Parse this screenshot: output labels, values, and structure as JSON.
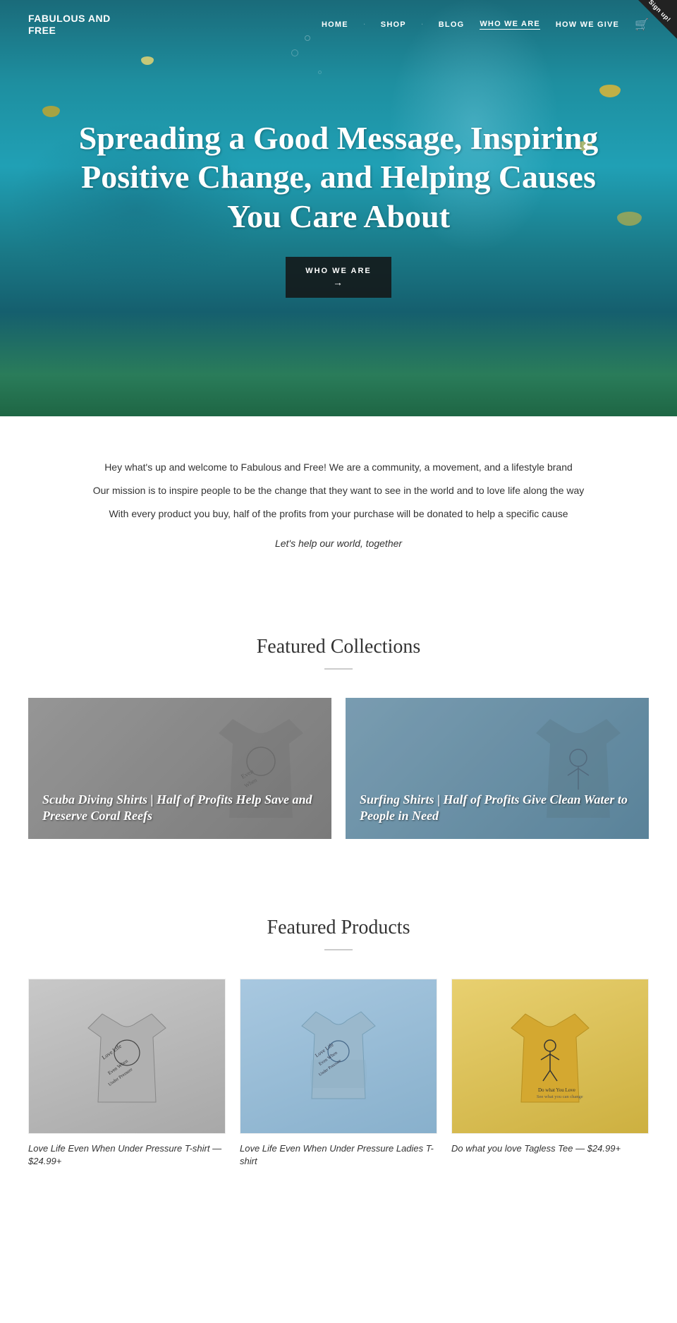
{
  "header": {
    "logo_line1": "FABULOUS AND",
    "logo_line2": "FREE",
    "nav": [
      {
        "label": "HOME",
        "active": false
      },
      {
        "label": "SHOP",
        "active": false,
        "has_dropdown": true
      },
      {
        "label": "BLOG",
        "active": false
      },
      {
        "label": "WHO WE ARE",
        "active": true
      },
      {
        "label": "HOW WE GIVE",
        "active": false
      }
    ],
    "signup_badge": "Sign up!"
  },
  "hero": {
    "title": "Spreading a Good Message, Inspiring Positive Change, and Helping Causes You Care About",
    "cta_button": "WHO WE ARE",
    "cta_arrow": "→"
  },
  "intro": {
    "line1": "Hey what's up and welcome to Fabulous and Free! We are a community, a movement, and a lifestyle brand",
    "line2": "Our mission is to inspire people to be the change that they want to see in the world and to love life along the way",
    "line3": "With every product you buy, half of the profits from your purchase will be donated to help a specific cause",
    "line4": "Let's help our world, together"
  },
  "featured_collections": {
    "section_title": "Featured Collections",
    "items": [
      {
        "title": "Scuba Diving Shirts | Half of Profits Help Save and Preserve Coral Reefs",
        "bg": "grey"
      },
      {
        "title": "Surfing Shirts | Half of Profits Give Clean Water to People in Need",
        "bg": "blue"
      }
    ]
  },
  "featured_products": {
    "section_title": "Featured Products",
    "items": [
      {
        "name": "Love Life Even When Under Pressure T-shirt",
        "price": "— $24.99+",
        "color": "grey"
      },
      {
        "name": "Love Life Even When Under Pressure Ladies T-shirt",
        "price": "",
        "color": "blue"
      },
      {
        "name": "Do what you love Tagless Tee",
        "price": "— $24.99+",
        "color": "yellow"
      }
    ]
  }
}
